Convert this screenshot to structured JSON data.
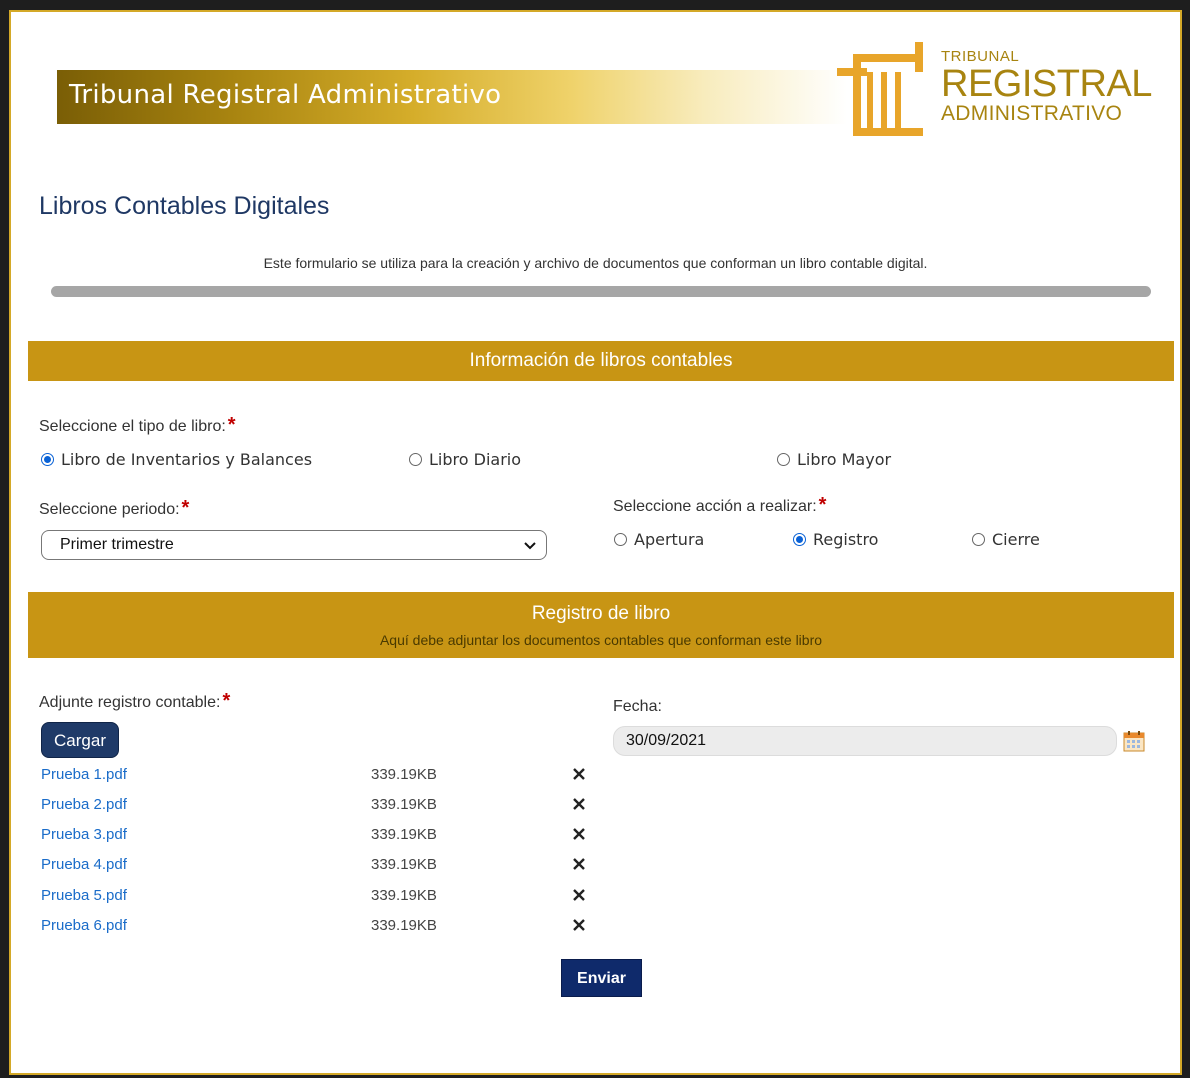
{
  "header": {
    "banner_title": "Tribunal Registral Administrativo",
    "logo": {
      "line1": "TRIBUNAL",
      "line2": "REGISTRAL",
      "line3": "ADMINISTRATIVO"
    }
  },
  "page": {
    "title": "Libros Contables Digitales",
    "description": "Este formulario se utiliza para la creación y archivo de documentos que conforman un libro contable digital."
  },
  "section_info": {
    "title": "Información de libros contables",
    "book_type_label": "Seleccione el tipo de libro:",
    "book_types": [
      {
        "label": "Libro de Inventarios y Balances",
        "selected": true
      },
      {
        "label": "Libro Diario",
        "selected": false
      },
      {
        "label": "Libro Mayor",
        "selected": false
      }
    ],
    "period_label": "Seleccione periodo:",
    "period_value": "Primer trimestre",
    "action_label": "Seleccione acción a realizar:",
    "actions": [
      {
        "label": "Apertura",
        "selected": false
      },
      {
        "label": "Registro",
        "selected": true
      },
      {
        "label": "Cierre",
        "selected": false
      }
    ],
    "required_mark": "*"
  },
  "section_registro": {
    "title": "Registro de libro",
    "subtitle": "Aquí debe adjuntar los documentos contables que conforman este libro",
    "attach_label": "Adjunte registro contable:",
    "upload_button": "Cargar",
    "files": [
      {
        "name": "Prueba 1.pdf",
        "size": "339.19KB"
      },
      {
        "name": "Prueba 2.pdf",
        "size": "339.19KB"
      },
      {
        "name": "Prueba 3.pdf",
        "size": "339.19KB"
      },
      {
        "name": "Prueba 4.pdf",
        "size": "339.19KB"
      },
      {
        "name": "Prueba 5.pdf",
        "size": "339.19KB"
      },
      {
        "name": "Prueba 6.pdf",
        "size": "339.19KB"
      }
    ],
    "date_label": "Fecha:",
    "date_value": "30/09/2021"
  },
  "submit_button": "Enviar",
  "colors": {
    "section_gold": "#c89514",
    "title_navy": "#1f3864",
    "link_blue": "#1a6cc9",
    "button_navy": "#0f2a6b",
    "required_red": "#c00000"
  },
  "icons": [
    "logo-columns-icon",
    "chevron-down-icon",
    "remove-file-icon",
    "calendar-icon"
  ]
}
